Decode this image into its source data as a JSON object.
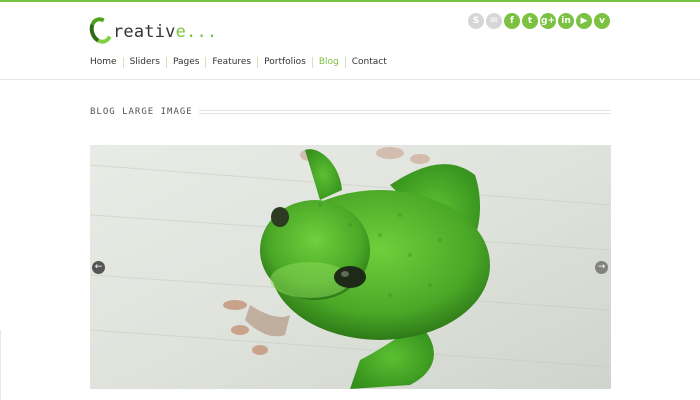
{
  "brand": {
    "logo_text": "reativ",
    "logo_accent": "e...",
    "accent_color": "#7cc242"
  },
  "social": [
    {
      "icon": "skype-icon",
      "glyph": "S",
      "muted": true
    },
    {
      "icon": "mail-icon",
      "glyph": "✉",
      "muted": true
    },
    {
      "icon": "facebook-icon",
      "glyph": "f",
      "muted": false
    },
    {
      "icon": "twitter-icon",
      "glyph": "t",
      "muted": false
    },
    {
      "icon": "google-plus-icon",
      "glyph": "g+",
      "muted": false
    },
    {
      "icon": "linkedin-icon",
      "glyph": "in",
      "muted": false
    },
    {
      "icon": "youtube-icon",
      "glyph": "▶",
      "muted": false
    },
    {
      "icon": "vimeo-icon",
      "glyph": "v",
      "muted": false
    }
  ],
  "nav": [
    {
      "label": "Home",
      "active": false
    },
    {
      "label": "Sliders",
      "active": false
    },
    {
      "label": "Pages",
      "active": false
    },
    {
      "label": "Features",
      "active": false
    },
    {
      "label": "Portfolios",
      "active": false
    },
    {
      "label": "Blog",
      "active": true
    },
    {
      "label": "Contact",
      "active": false
    }
  ],
  "page": {
    "section_title": "BLOG LARGE IMAGE"
  },
  "slider": {
    "prev_glyph": "←",
    "next_glyph": "→"
  }
}
